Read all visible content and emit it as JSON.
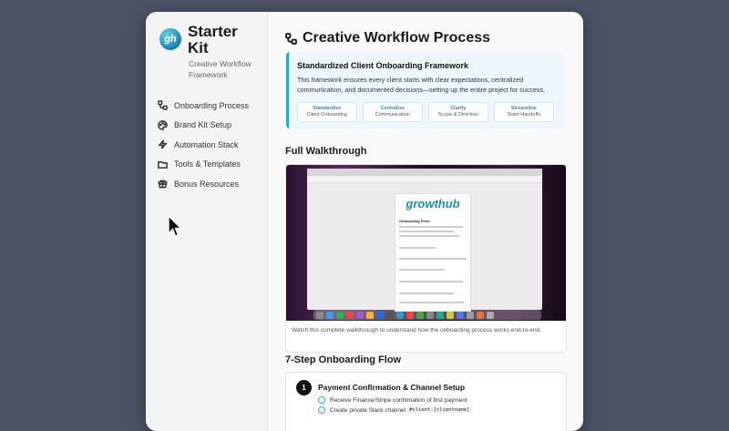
{
  "brand": {
    "logo_text": "gh",
    "title": "Starter Kit",
    "subtitle": "Creative Workflow Framework"
  },
  "nav": {
    "items": [
      {
        "label": "Onboarding Process",
        "icon": "workflow-icon"
      },
      {
        "label": "Brand Kit Setup",
        "icon": "palette-icon"
      },
      {
        "label": "Automation Stack",
        "icon": "lightning-icon"
      },
      {
        "label": "Tools & Templates",
        "icon": "folder-icon"
      },
      {
        "label": "Bonus Resources",
        "icon": "gift-icon"
      }
    ]
  },
  "page": {
    "title": "Creative Workflow Process"
  },
  "framework": {
    "title": "Standardized Client Onboarding Framework",
    "description": "This framework ensures every client starts with clear expectations, centralized communication, and documented decisions—setting up the entire project for success.",
    "steps": [
      {
        "title": "Standardize",
        "sub": "Client Onboarding"
      },
      {
        "title": "Centralize",
        "sub": "Communication"
      },
      {
        "title": "Clarify",
        "sub": "Scope & Direction"
      },
      {
        "title": "Streamline",
        "sub": "Team Handoffs"
      }
    ]
  },
  "walkthrough": {
    "heading": "Full Walkthrough",
    "video_logo": "growthub",
    "video_form_title": "Onboarding Form",
    "caption": "Watch this complete walkthrough to understand how the onboarding process works end-to-end."
  },
  "flow": {
    "heading": "7-Step Onboarding Flow",
    "step_number": "1",
    "step_title": "Payment Confirmation & Channel Setup",
    "checks": [
      "Receive Finance/Stripe confirmation of first payment",
      "Create private Slack channel"
    ],
    "code": "#client-[clientname]"
  },
  "colors": {
    "accent": "#2aa8d0",
    "background": "#4a5264"
  }
}
